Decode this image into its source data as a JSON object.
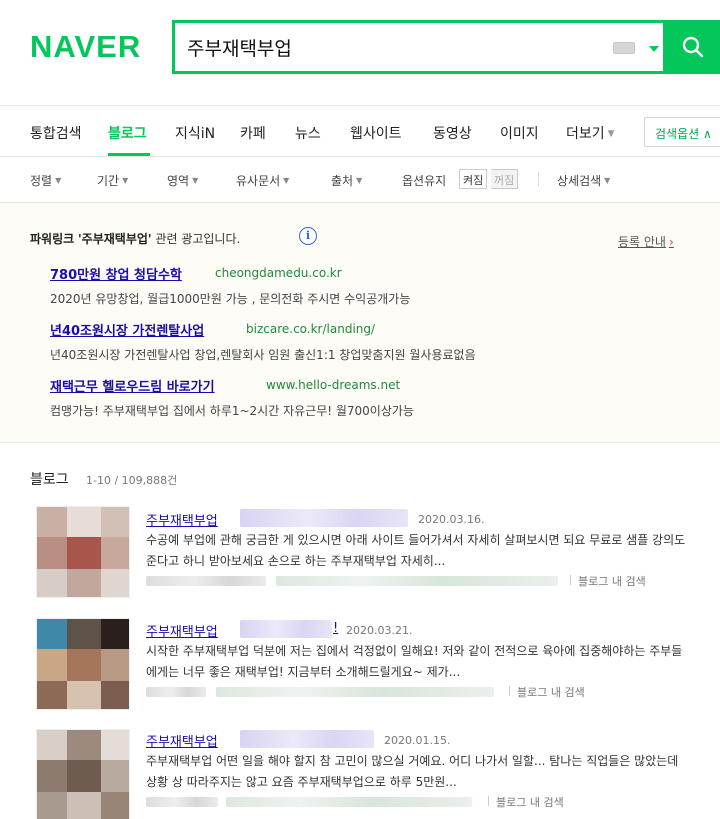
{
  "header": {
    "logo": "NAVER",
    "search_query": "주부재택부업"
  },
  "tabs": {
    "items": [
      "통합검색",
      "블로그",
      "지식iN",
      "카페",
      "뉴스",
      "웹사이트",
      "동영상",
      "이미지",
      "더보기"
    ],
    "active": "블로그",
    "search_options": "검색옵션 ∧"
  },
  "filters": {
    "items": [
      "정렬",
      "기간",
      "영역",
      "유사문서",
      "출처"
    ],
    "option_keep": "옵션유지",
    "on": "켜짐",
    "off": "꺼짐",
    "detail": "상세검색"
  },
  "ads": {
    "title_prefix": "파워링크",
    "title_query": "'주부재택부업'",
    "title_suffix": "관련 광고입니다.",
    "register": "등록 안내",
    "items": [
      {
        "title": "780만원 창업 청담수학",
        "url": "cheongdamedu.co.kr",
        "desc": "2020년 유망창업, 월급1000만원 가능 , 문의전화 주시면 수익공개가능"
      },
      {
        "title": "년40조원시장 가전렌탈사업",
        "url": "bizcare.co.kr/landing/",
        "desc": "년40조원시장 가전렌탈사업 창업,렌탈회사 임원 출신1:1 창업맞춤지원 월사용료없음"
      },
      {
        "title": "재택근무 헬로우드림 바로가기",
        "url": "www.hello-dreams.net",
        "desc": "컴맹가능! 주부재택부업 집에서 하루1~2시간 자유근무! 월700이상가능"
      }
    ]
  },
  "blog": {
    "heading": "블로그",
    "count": "1-10 / 109,888건",
    "inner_search": "블로그 내 검색",
    "results": [
      {
        "title": "주부재택부업",
        "date": "2020.03.16.",
        "desc": "수공예 부업에 관해 궁금한 게 있으시면 아래 사이트 들어가셔서 자세히 살펴보시면 되요 무료로 샘플 강의도 준다고 하니 받아보세요 손으로 하는 주부재택부업 자세히..."
      },
      {
        "title": "주부재택부업",
        "title_tail": "!",
        "date": "2020.03.21.",
        "desc": "시작한 주부재택부업 덕분에 저는 집에서 걱정없이 일해요! 저와 같이 전적으로 육아에 집중해야하는 주부들에게는 너무 좋은 재택부업! 지금부터 소개해드릴게요~ 제가..."
      },
      {
        "title": "주부재택부업",
        "date": "2020.01.15.",
        "desc": "주부재택부업 어떤 일을 해야 할지 참 고민이 많으실 거예요. 어디 나가서 일할... 탐나는 직업들은 많았는데 상황 상 따라주지는 않고 요즘 주부재택부업으로 하루 5만원..."
      }
    ]
  }
}
